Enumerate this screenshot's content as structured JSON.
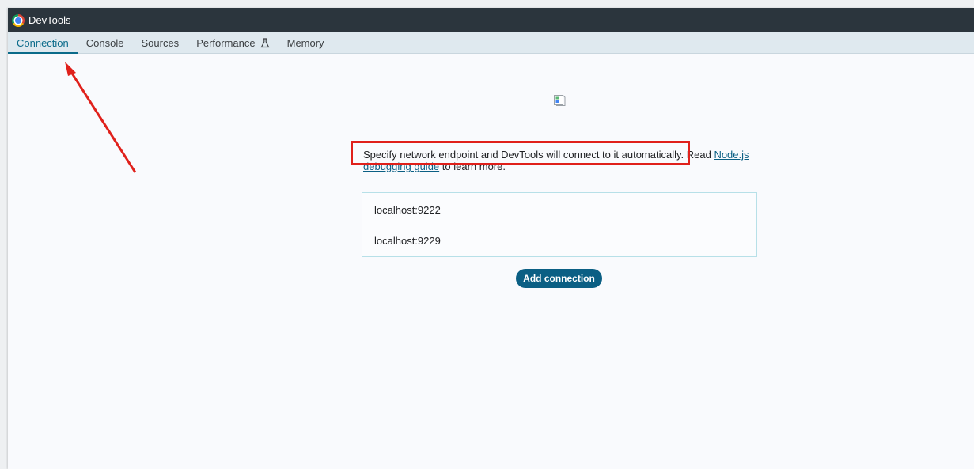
{
  "window": {
    "title": "DevTools"
  },
  "tabs": [
    {
      "label": "Connection",
      "active": true
    },
    {
      "label": "Console",
      "active": false
    },
    {
      "label": "Sources",
      "active": false
    },
    {
      "label": "Performance",
      "active": false
    },
    {
      "label": "Memory",
      "active": false
    }
  ],
  "content": {
    "message_text": "Specify network endpoint and DevTools will connect to it automatically. Read ",
    "link_text": "Node.js debugging guide",
    "message_suffix": " to learn more.",
    "connections": [
      "localhost:9222",
      "localhost:9229"
    ],
    "add_button_label": "Add connection"
  },
  "colors": {
    "titlebar": "#2b353d",
    "tabbar": "#dfe9ef",
    "accent": "#0b5f84",
    "annotation": "#e0201b"
  },
  "icons": {
    "app": "chrome-icon",
    "experimental": "flask-icon",
    "image": "broken-image-icon"
  }
}
